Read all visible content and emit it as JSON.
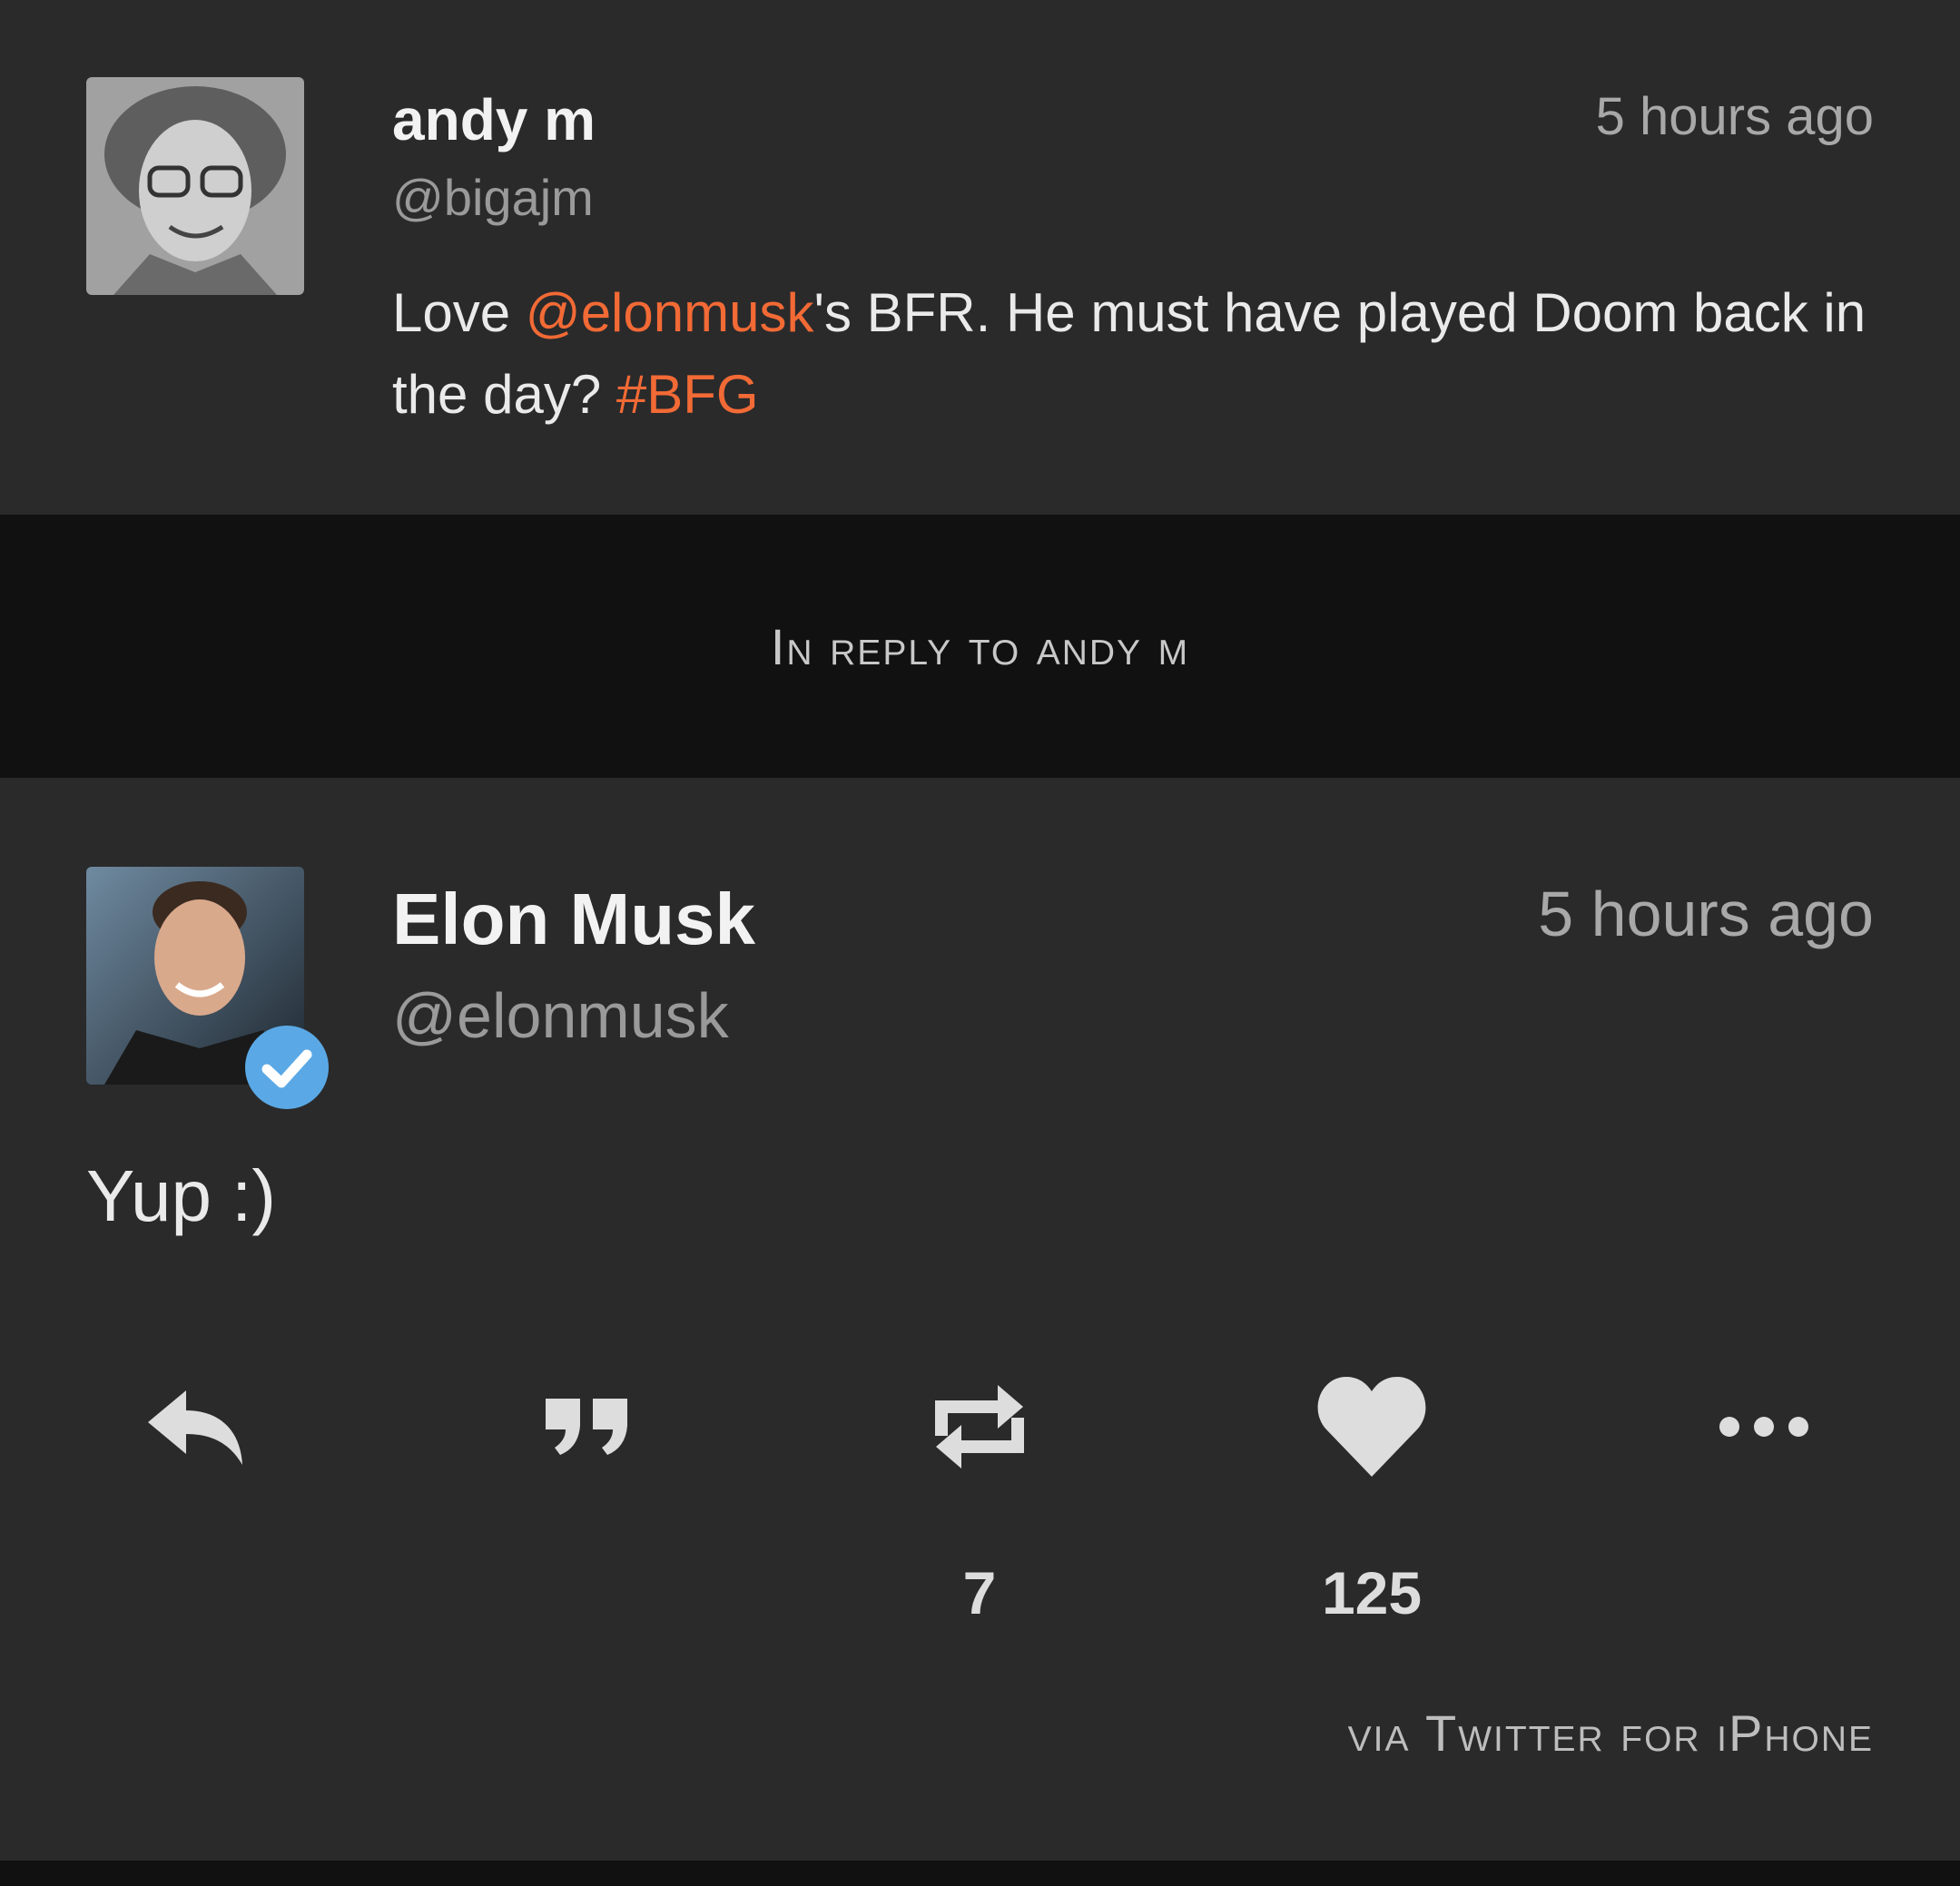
{
  "colors": {
    "card_background": "#2a2a2b",
    "page_background": "#111111",
    "accent": "#f26a35",
    "verified_badge": "#5aa9e6",
    "icon": "#dddddd"
  },
  "original_tweet": {
    "author_name": "andy m",
    "handle": "@bigajm",
    "timestamp": "5 hours ago",
    "text_before": "Love ",
    "mention": "@elonmusk",
    "text_middle": "'s BFR. He must have played Doom back in the day? ",
    "hashtag": "#BFG"
  },
  "reply_banner": {
    "label": "In reply to andy m"
  },
  "main_tweet": {
    "author_name": "Elon Musk",
    "handle": "@elonmusk",
    "timestamp": "5 hours ago",
    "verified": true,
    "text": "Yup :)",
    "source": "via Twitter for iPhone"
  },
  "actions": [
    {
      "name": "reply",
      "icon": "reply-icon",
      "count": ""
    },
    {
      "name": "quote",
      "icon": "quote-icon",
      "count": ""
    },
    {
      "name": "retweet",
      "icon": "retweet-icon",
      "count": "7"
    },
    {
      "name": "like",
      "icon": "heart-icon",
      "count": "125"
    },
    {
      "name": "more",
      "icon": "more-icon",
      "count": ""
    }
  ]
}
